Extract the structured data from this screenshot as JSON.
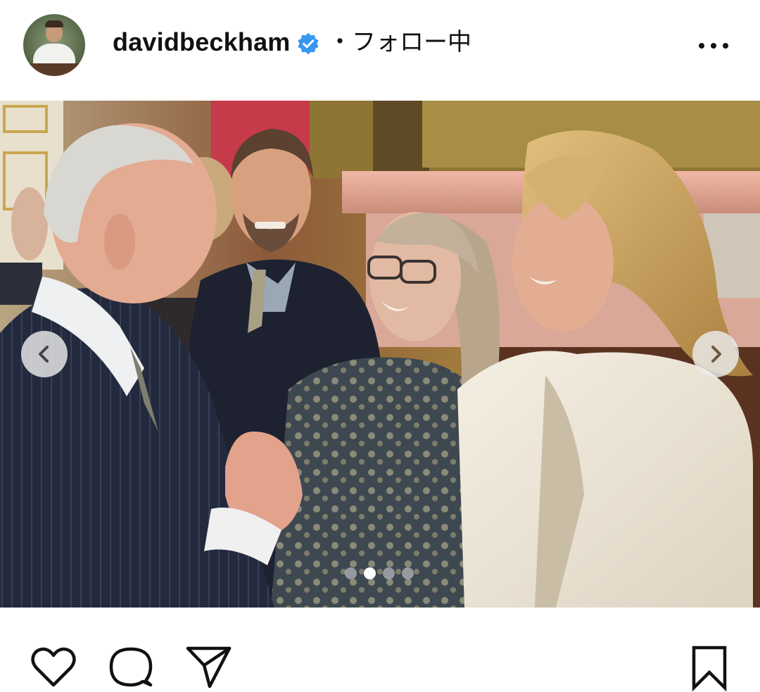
{
  "post": {
    "username": "davidbeckham",
    "follow_separator": "・",
    "follow_status": "フォロー中"
  },
  "icons": {
    "verified": "verified-badge-icon",
    "more": "more-options-icon",
    "prev": "chevron-left-icon",
    "next": "chevron-right-icon",
    "like": "heart-icon",
    "comment": "comment-bubble-icon",
    "share": "paper-plane-icon",
    "save": "bookmark-icon"
  },
  "carousel": {
    "slide_count": 4,
    "active_index": 1
  },
  "colors": {
    "verified_blue": "#3897f0",
    "text": "#111111",
    "background": "#ffffff"
  }
}
